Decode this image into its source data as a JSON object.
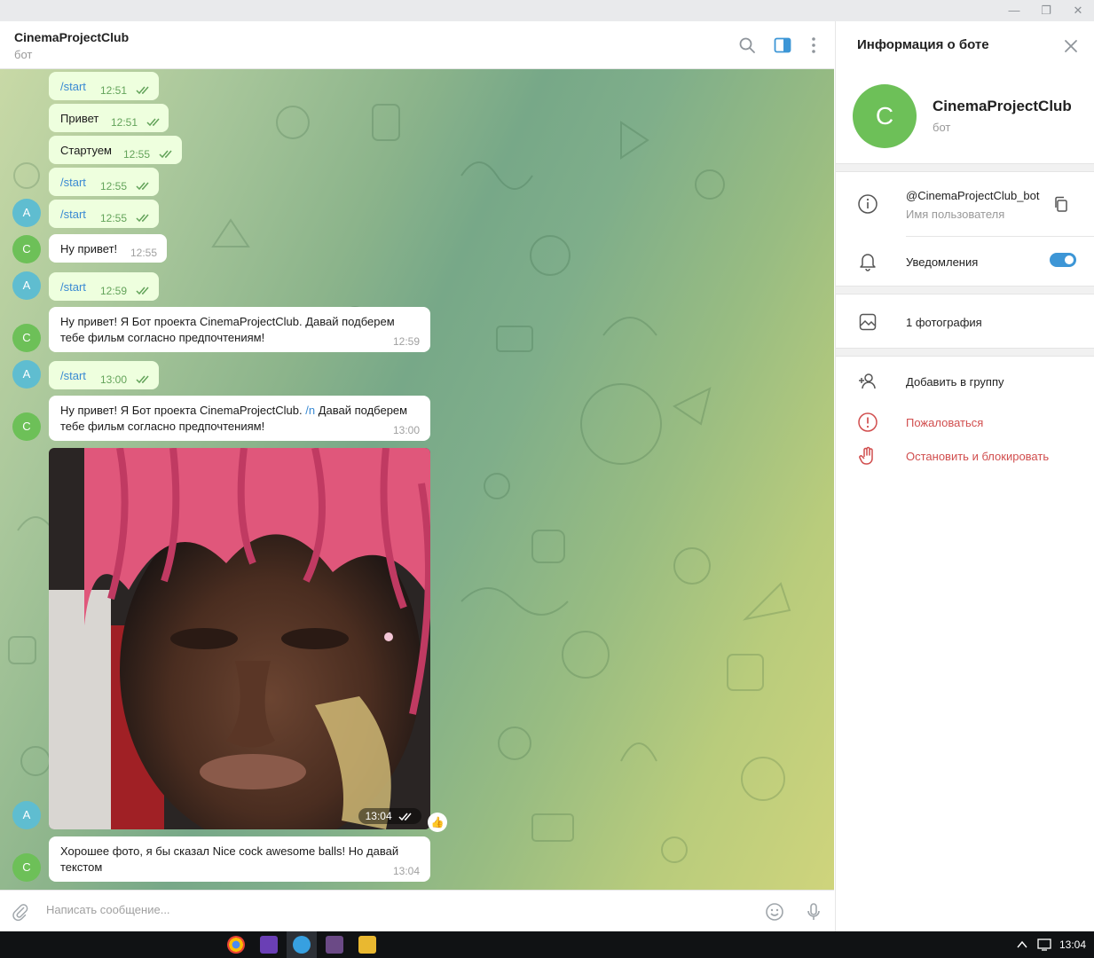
{
  "chat": {
    "title": "CinemaProjectClub",
    "subtitle": "бот"
  },
  "messages": [
    {
      "text": "/start",
      "time": "12:51"
    },
    {
      "text": "Привет",
      "time": "12:51"
    },
    {
      "text": "Стартуем",
      "time": "12:55"
    },
    {
      "text": "/start",
      "time": "12:55"
    },
    {
      "text": "/start",
      "time": "12:55"
    },
    {
      "text": "Ну привет!",
      "time": "12:55"
    },
    {
      "text": "/start",
      "time": "12:59"
    },
    {
      "line1": "Ну привет! Я Бот проекта CinemaProjectClub. Давай подберем",
      "line2": "тебе фильм согласно предпочтениям!",
      "time": "12:59"
    },
    {
      "text": "/start",
      "time": "13:00"
    },
    {
      "line1_a": "Ну привет! Я Бот проекта CinemaProjectClub. ",
      "line1_b": "/n",
      "line1_c": " Давай подберем",
      "line2": "тебе фильм согласно предпочтениям!",
      "time": "13:00"
    },
    {
      "photo_time": "13:04",
      "reaction": "👍"
    },
    {
      "line1": "Хорошее фото, я бы сказал Nice cock awesome balls! Но давай",
      "line2": "текстом",
      "time": "13:04"
    }
  ],
  "avatars": {
    "user": "A",
    "bot": "C"
  },
  "composer": {
    "placeholder": "Написать сообщение..."
  },
  "panel": {
    "title": "Информация о боте",
    "avatar_letter": "C",
    "name": "CinemaProjectClub",
    "sub": "бот",
    "username": "@CinemaProjectClub_bot",
    "username_label": "Имя пользователя",
    "notifications": "Уведомления",
    "notifications_on": true,
    "photos": "1 фотография",
    "add_to_group": "Добавить в группу",
    "report": "Пожаловаться",
    "block": "Остановить и блокировать"
  },
  "taskbar": {
    "clock": "13:04"
  },
  "colors": {
    "accent": "#3d96d6",
    "out_bubble": "#eeffde",
    "bot_avatar": "#6dc058",
    "user_avatar": "#5fbdd0",
    "danger": "#d14e4e"
  }
}
